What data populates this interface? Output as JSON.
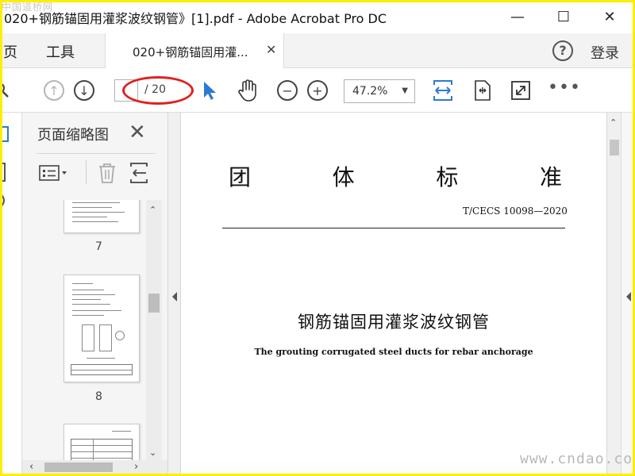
{
  "window": {
    "title": "020+钢筋锚固用灌浆波纹钢管》[1].pdf - Adobe Acrobat Pro DC",
    "watermark_logo": "中国道桥网",
    "minimize_glyph": "—",
    "maximize_glyph": "☐",
    "close_glyph": "✕"
  },
  "menu": {
    "home_label": "主页",
    "tools_label": "工具",
    "login_label": "登录",
    "help_glyph": "?"
  },
  "tab": {
    "label": "020+钢筋锚固用灌...",
    "close_glyph": "✕"
  },
  "toolbar": {
    "page_current": "",
    "page_total": "/ 20",
    "zoom": "47.2%",
    "more_glyph": "•••",
    "accent_color": "#2b7bd1",
    "highlight_color": "#e02020"
  },
  "thumbnails": {
    "title": "页面缩略图",
    "close_glyph": "✕",
    "pages": [
      {
        "num": "7"
      },
      {
        "num": "8"
      },
      {
        "num": ""
      }
    ]
  },
  "document": {
    "heading_chars": [
      "团",
      "体",
      "标",
      "准"
    ],
    "code": "T/CECS 10098—2020",
    "title_cn": "钢筋锚固用灌浆波纹钢管",
    "title_en": "The grouting corrugated steel ducts for rebar anchorage"
  },
  "watermark_url": "www.cndao.com"
}
